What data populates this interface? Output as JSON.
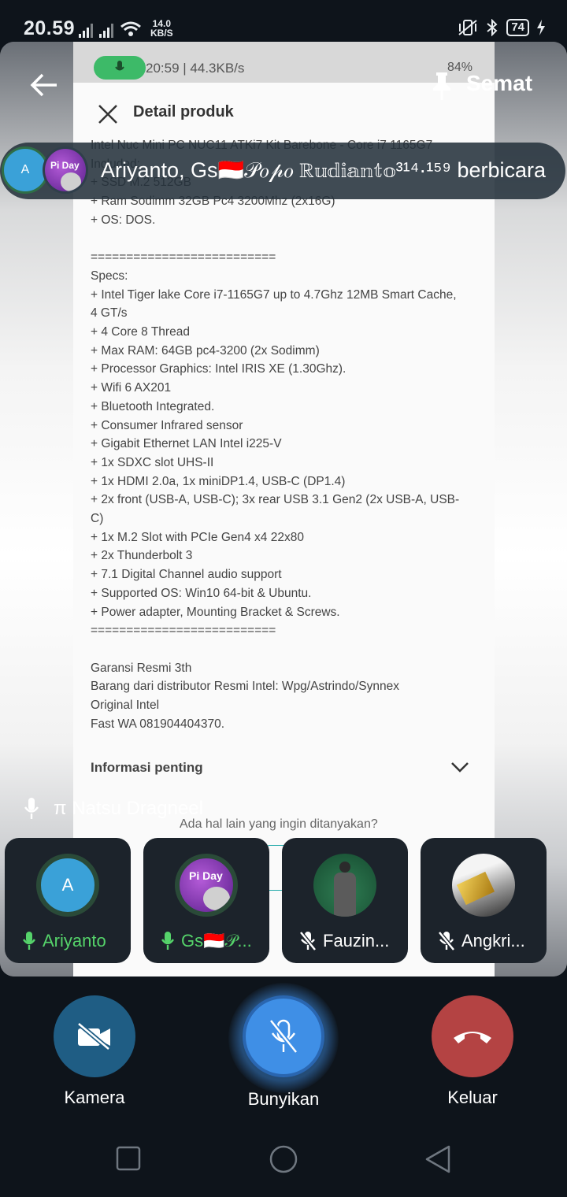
{
  "status_bar": {
    "time": "20.59",
    "net_speed_value": "14.0",
    "net_speed_unit": "KB/S",
    "battery": "74"
  },
  "shared_screen": {
    "status_time_speed": "20:59 | 44.3KB/s",
    "status_battery": "84%",
    "title": "Detail produk",
    "body_text": "Intel Nuc Mini PC NUC11 ATKi7 Kit Barebone - Core i7 1165G7\nIncluded:\n+ SSD M.2 512GB\n+ Ram Sodimm 32GB Pc4 3200Mhz (2x16G)\n+ OS: DOS.\n\n==========================\nSpecs:\n+ Intel Tiger lake Core i7-1165G7 up to 4.7Ghz 12MB Smart Cache, 4 GT/s\n+ 4 Core 8 Thread\n+ Max RAM: 64GB pc4-3200 (2x Sodimm)\n+ Processor Graphics: Intel IRIS XE (1.30Ghz).\n+ Wifi 6 AX201\n+ Bluetooth Integrated.\n+ Consumer Infrared sensor\n+ Gigabit Ethernet LAN Intel i225-V\n+ 1x SDXC slot UHS-II\n+ 1x HDMI 2.0a, 1x miniDP1.4, USB-C (DP1.4)\n+ 2x front (USB-A, USB-C); 3x rear USB 3.1 Gen2 (2x USB-A, USB-C)\n+ 1x M.2 Slot with PCIe Gen4 x4 22x80\n+ 2x Thunderbolt 3\n+ 7.1 Digital Channel audio support\n+ Supported OS: Win10 64-bit & Ubuntu.\n+ Power adapter, Mounting Bracket & Screws.\n==========================\n\nGaransi Resmi 3th\nBarang dari distributor Resmi Intel: Wpg/Astrindo/Synnex\nOriginal Intel\nFast WA 081904404370.",
    "info_label": "Informasi penting",
    "ask_text": "Ada hal lain yang ingin ditanyakan?"
  },
  "header": {
    "pin_label": "Semat"
  },
  "banner": {
    "speakers_text": "Ariyanto, Gs🇮🇩𝒫𝑜𝓅𝑜 ℝ𝕦𝕕𝕚𝕒𝕟𝕥𝕠³¹⁴·¹⁵⁹ berbicara",
    "avatar_letter": "A"
  },
  "current_speaker": {
    "name": "π Natsu Dragneel"
  },
  "participants": [
    {
      "name": "Ariyanto",
      "avatar_letter": "A",
      "mic": "on"
    },
    {
      "name": "Gs🇮🇩𝒫...",
      "mic": "on",
      "avatar_text": "Pi Day"
    },
    {
      "name": "Fauzin...",
      "mic": "muted"
    },
    {
      "name": "Angkri...",
      "mic": "muted"
    }
  ],
  "controls": {
    "camera": "Kamera",
    "unmute": "Bunyikan",
    "leave": "Keluar"
  },
  "colors": {
    "accent_blue": "#3f8fe6",
    "leave_red": "#b44343",
    "camera_blue": "#1f5d84",
    "mic_green": "#55d36a"
  }
}
